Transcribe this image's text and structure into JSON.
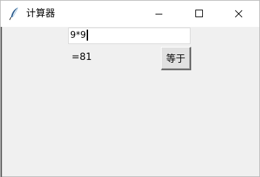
{
  "window": {
    "title": "计算器",
    "icon": "feather-icon"
  },
  "titlebar_controls": {
    "minimize": "minimize-icon",
    "maximize": "maximize-icon",
    "close": "close-icon"
  },
  "calculator": {
    "expression_value": "9*9",
    "result_text": "=81",
    "equals_label": "等于"
  }
}
